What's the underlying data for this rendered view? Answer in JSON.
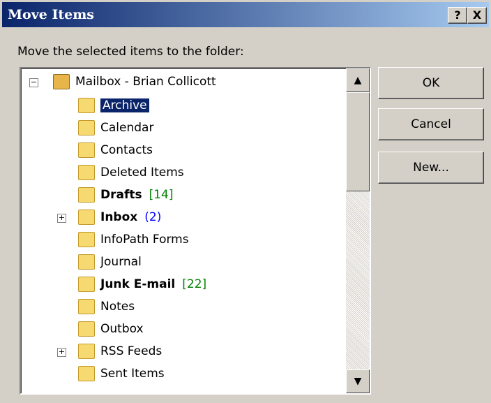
{
  "title": "Move Items",
  "titlebar_buttons": {
    "help": "?",
    "close": "X"
  },
  "prompt": "Move the selected items to the folder:",
  "tree": {
    "root": "Mailbox - Brian Collicott",
    "items": [
      {
        "label": "Archive",
        "count": "",
        "selected": true,
        "bold": false
      },
      {
        "label": "Calendar",
        "count": "",
        "selected": false,
        "bold": false
      },
      {
        "label": "Contacts",
        "count": "",
        "selected": false,
        "bold": false
      },
      {
        "label": "Deleted Items",
        "count": "",
        "selected": false,
        "bold": false
      },
      {
        "label": "Drafts",
        "count": "[14]",
        "selected": false,
        "bold": true
      },
      {
        "label": "Inbox",
        "count": "(2)",
        "selected": false,
        "bold": true,
        "expandable": true
      },
      {
        "label": "InfoPath Forms",
        "count": "",
        "selected": false,
        "bold": false
      },
      {
        "label": "Journal",
        "count": "",
        "selected": false,
        "bold": false
      },
      {
        "label": "Junk E-mail",
        "count": "[22]",
        "selected": false,
        "bold": true
      },
      {
        "label": "Notes",
        "count": "",
        "selected": false,
        "bold": false
      },
      {
        "label": "Outbox",
        "count": "",
        "selected": false,
        "bold": false
      },
      {
        "label": "RSS Feeds",
        "count": "",
        "selected": false,
        "bold": false,
        "expandable": true
      },
      {
        "label": "Sent Items",
        "count": "",
        "selected": false,
        "bold": false
      }
    ]
  },
  "buttons": {
    "ok": "OK",
    "cancel": "Cancel",
    "new": "New..."
  },
  "colors": {
    "titlebar_start": "#0a246a",
    "titlebar_end": "#a6caf0",
    "selection": "#0a246a",
    "count_green": "#008000",
    "count_blue": "#0000ff"
  }
}
